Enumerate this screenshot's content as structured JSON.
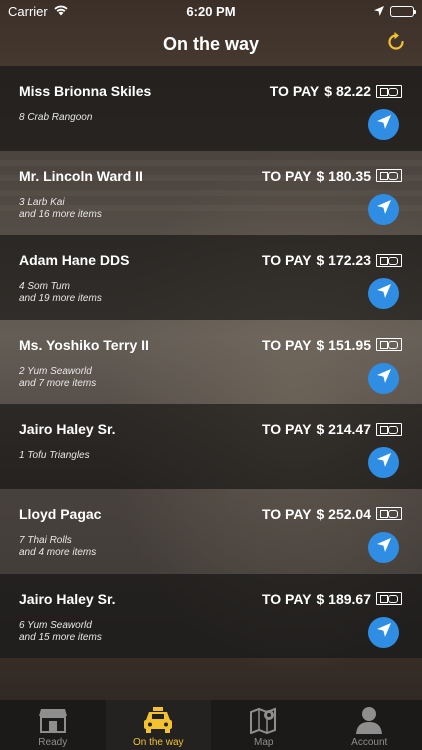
{
  "status_bar": {
    "carrier": "Carrier",
    "time": "6:20 PM",
    "icons": [
      "wifi-icon",
      "location-arrow-icon",
      "battery-icon"
    ]
  },
  "nav": {
    "title": "On the way",
    "refresh_icon": "refresh-icon"
  },
  "colors": {
    "accent": "#f2c230",
    "nav_button": "#2f8de4",
    "tab_inactive": "#8e8e8e"
  },
  "orders": [
    {
      "name": "Miss Brionna Skiles",
      "pay_label": "TO PAY",
      "amount": "$ 82.22",
      "items_line1": "8 Crab Rangoon",
      "items_line2": ""
    },
    {
      "name": "Mr. Lincoln Ward II",
      "pay_label": "TO PAY",
      "amount": "$ 180.35",
      "items_line1": "3 Larb Kai",
      "items_line2": "and 16 more items"
    },
    {
      "name": "Adam Hane DDS",
      "pay_label": "TO PAY",
      "amount": "$ 172.23",
      "items_line1": "4 Som Tum",
      "items_line2": "and 19 more items"
    },
    {
      "name": "Ms. Yoshiko Terry II",
      "pay_label": "TO PAY",
      "amount": "$ 151.95",
      "items_line1": "2 Yum Seaworld",
      "items_line2": "and 7 more items"
    },
    {
      "name": "Jairo Haley Sr.",
      "pay_label": "TO PAY",
      "amount": "$ 214.47",
      "items_line1": "1 Tofu Triangles",
      "items_line2": ""
    },
    {
      "name": "Lloyd Pagac",
      "pay_label": "TO PAY",
      "amount": "$ 252.04",
      "items_line1": "7 Thai Rolls",
      "items_line2": "and 4 more items"
    },
    {
      "name": "Jairo Haley Sr.",
      "pay_label": "TO PAY",
      "amount": "$ 189.67",
      "items_line1": "6 Yum Seaworld",
      "items_line2": "and 15 more items"
    }
  ],
  "tabs": [
    {
      "label": "Ready",
      "icon": "store-icon",
      "active": false
    },
    {
      "label": "On the way",
      "icon": "taxi-icon",
      "active": true
    },
    {
      "label": "Map",
      "icon": "map-icon",
      "active": false
    },
    {
      "label": "Account",
      "icon": "user-icon",
      "active": false
    }
  ]
}
